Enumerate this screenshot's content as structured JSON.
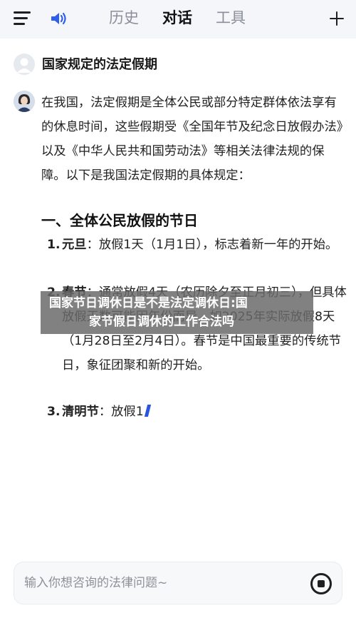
{
  "header": {
    "tabs": [
      "历史",
      "对话",
      "工具"
    ],
    "active_tab": "对话",
    "icons": [
      "menu-icon",
      "speaker-icon",
      "plus-icon"
    ]
  },
  "conversation": {
    "question": "国家规定的法定假期",
    "answer_intro": "在我国，法定假期是全体公民或部分特定群体依法享有的休息时间，这些假期受《全国年节及纪念日放假办法》以及《中华人民共和国劳动法》等相关法律法规的保障。以下是我国法定假期的具体规定：",
    "section_heading": "一、全体公民放假的节日",
    "items": [
      {
        "num": "1.",
        "title": "元旦",
        "text": "：放假1天（1月1日），标志着新一年的开始。"
      },
      {
        "num": "2.",
        "title": "春节",
        "text": "：通常放假4天（农历除夕至正月初三），但具体放假天数可能因年份而异，如2025年实际放假8天（1月28日至2月4日）。春节是中国最重要的传统节日，象征团聚和新的开始。"
      },
      {
        "num": "3.",
        "title": "清明节",
        "text": "：放假1"
      }
    ]
  },
  "overlay": {
    "line1": "国家节日调休日是不是法定调休日:国",
    "line2": "家节假日调休的工作合法吗"
  },
  "input": {
    "placeholder": "输入你想咨询的法律问题~",
    "value": ""
  },
  "colors": {
    "accent": "#2a55e0",
    "header_bg": "#f4f6fa",
    "speaker_blue": "#2f5fe8"
  }
}
